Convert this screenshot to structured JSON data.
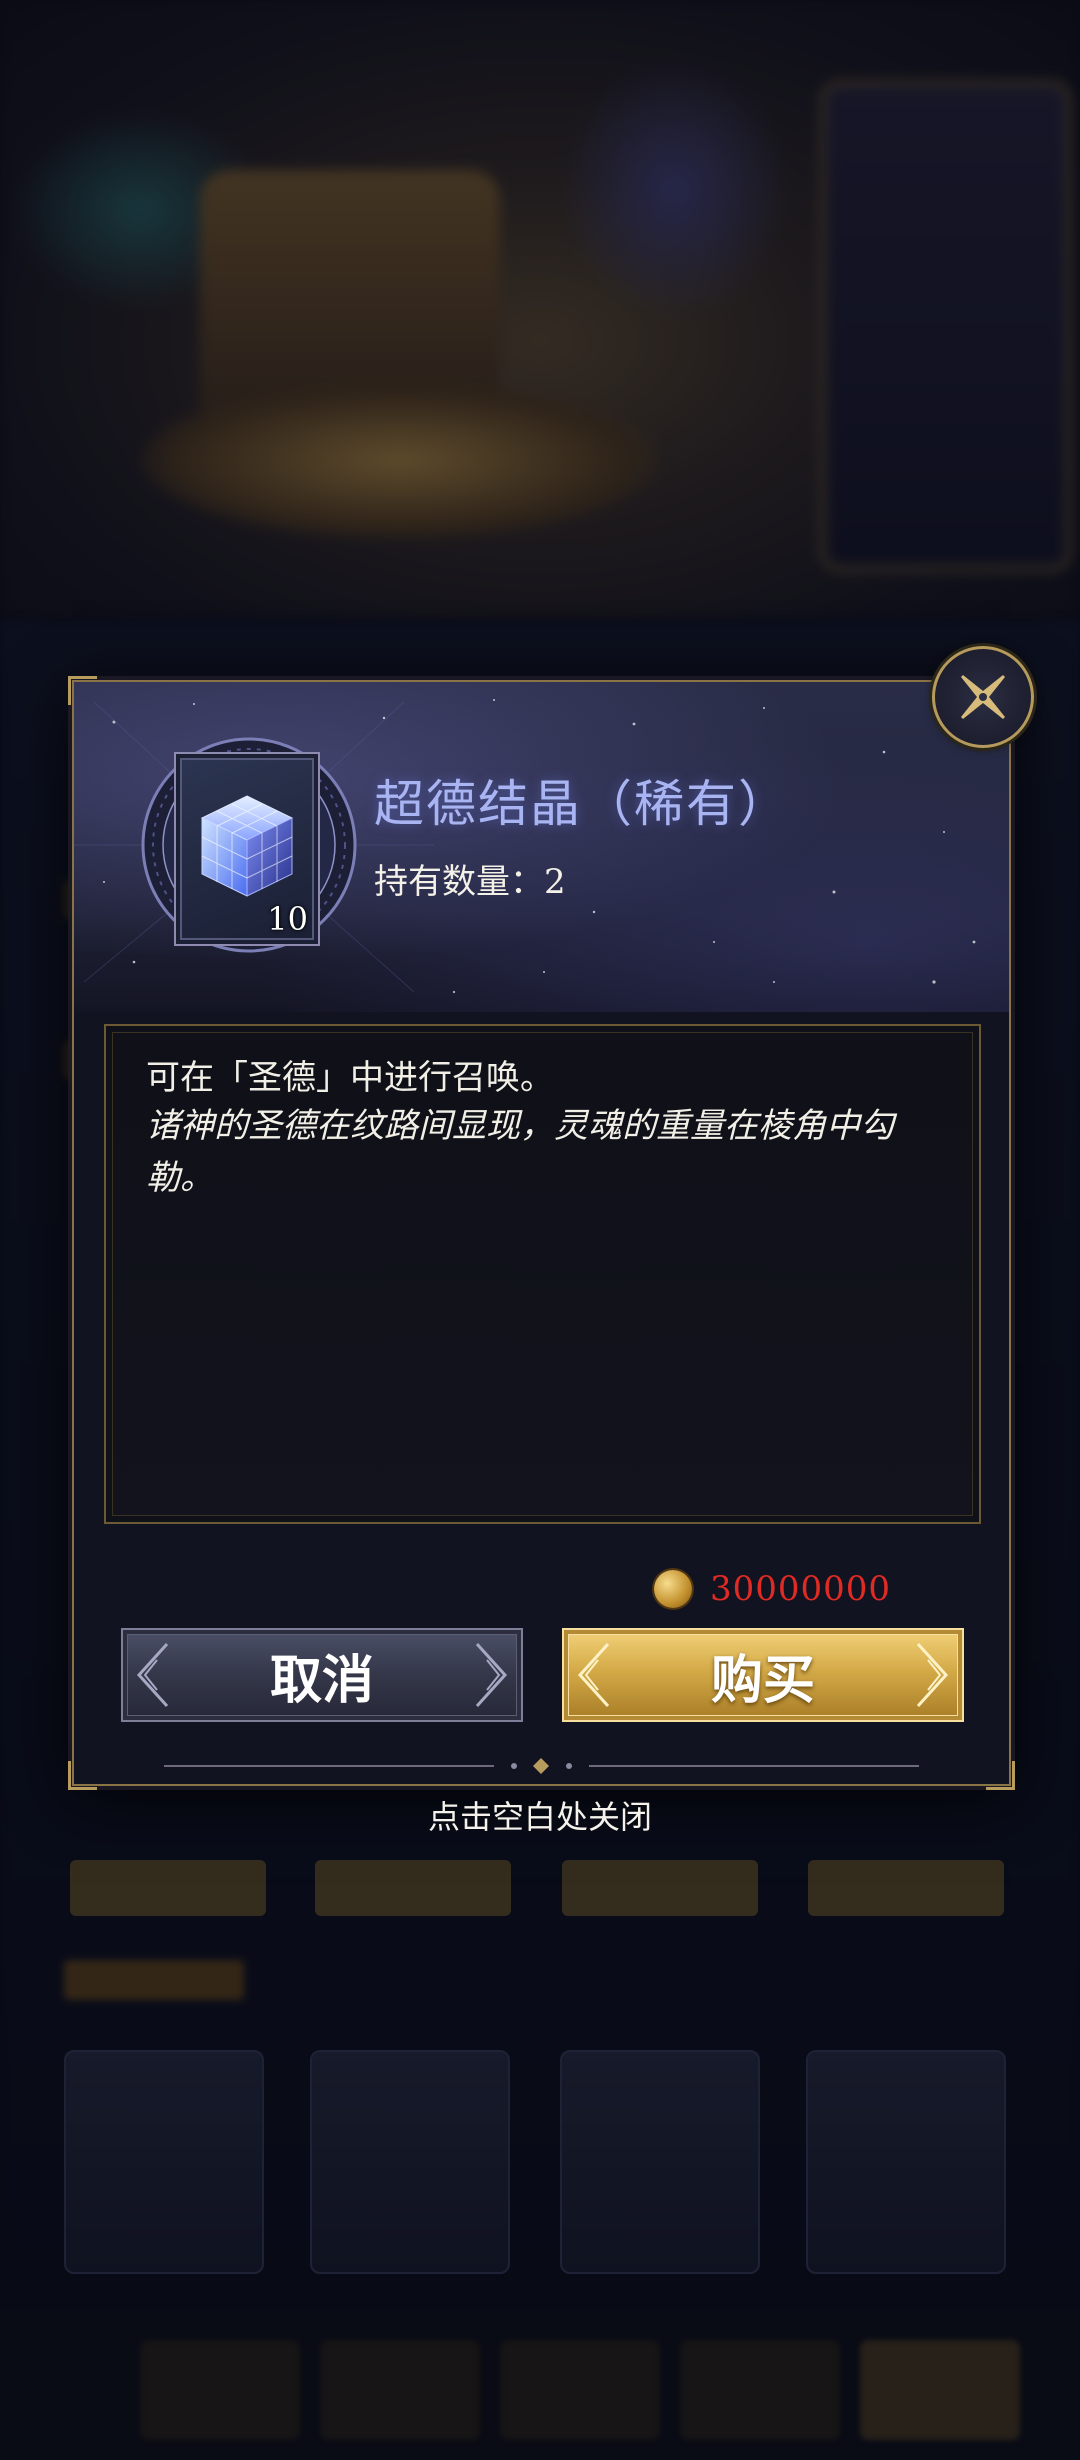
{
  "item": {
    "name": "超德结晶（稀有）",
    "owned_label": "持有数量：2",
    "card_count": "10"
  },
  "description": {
    "line1": "可在「圣德」中进行召唤。",
    "line2": "诸神的圣德在纹路间显现，灵魂的重量在棱角中勾勒。"
  },
  "price": {
    "value": "30000000",
    "currency_icon": "gold-coin-icon"
  },
  "buttons": {
    "cancel": "取消",
    "buy": "购买"
  },
  "hint": "点击空白处关闭",
  "colors": {
    "title": "#a9b4f2",
    "price": "#e02a24",
    "frame_gold": "#8a7446",
    "buy_gold": "#d4aa48"
  }
}
